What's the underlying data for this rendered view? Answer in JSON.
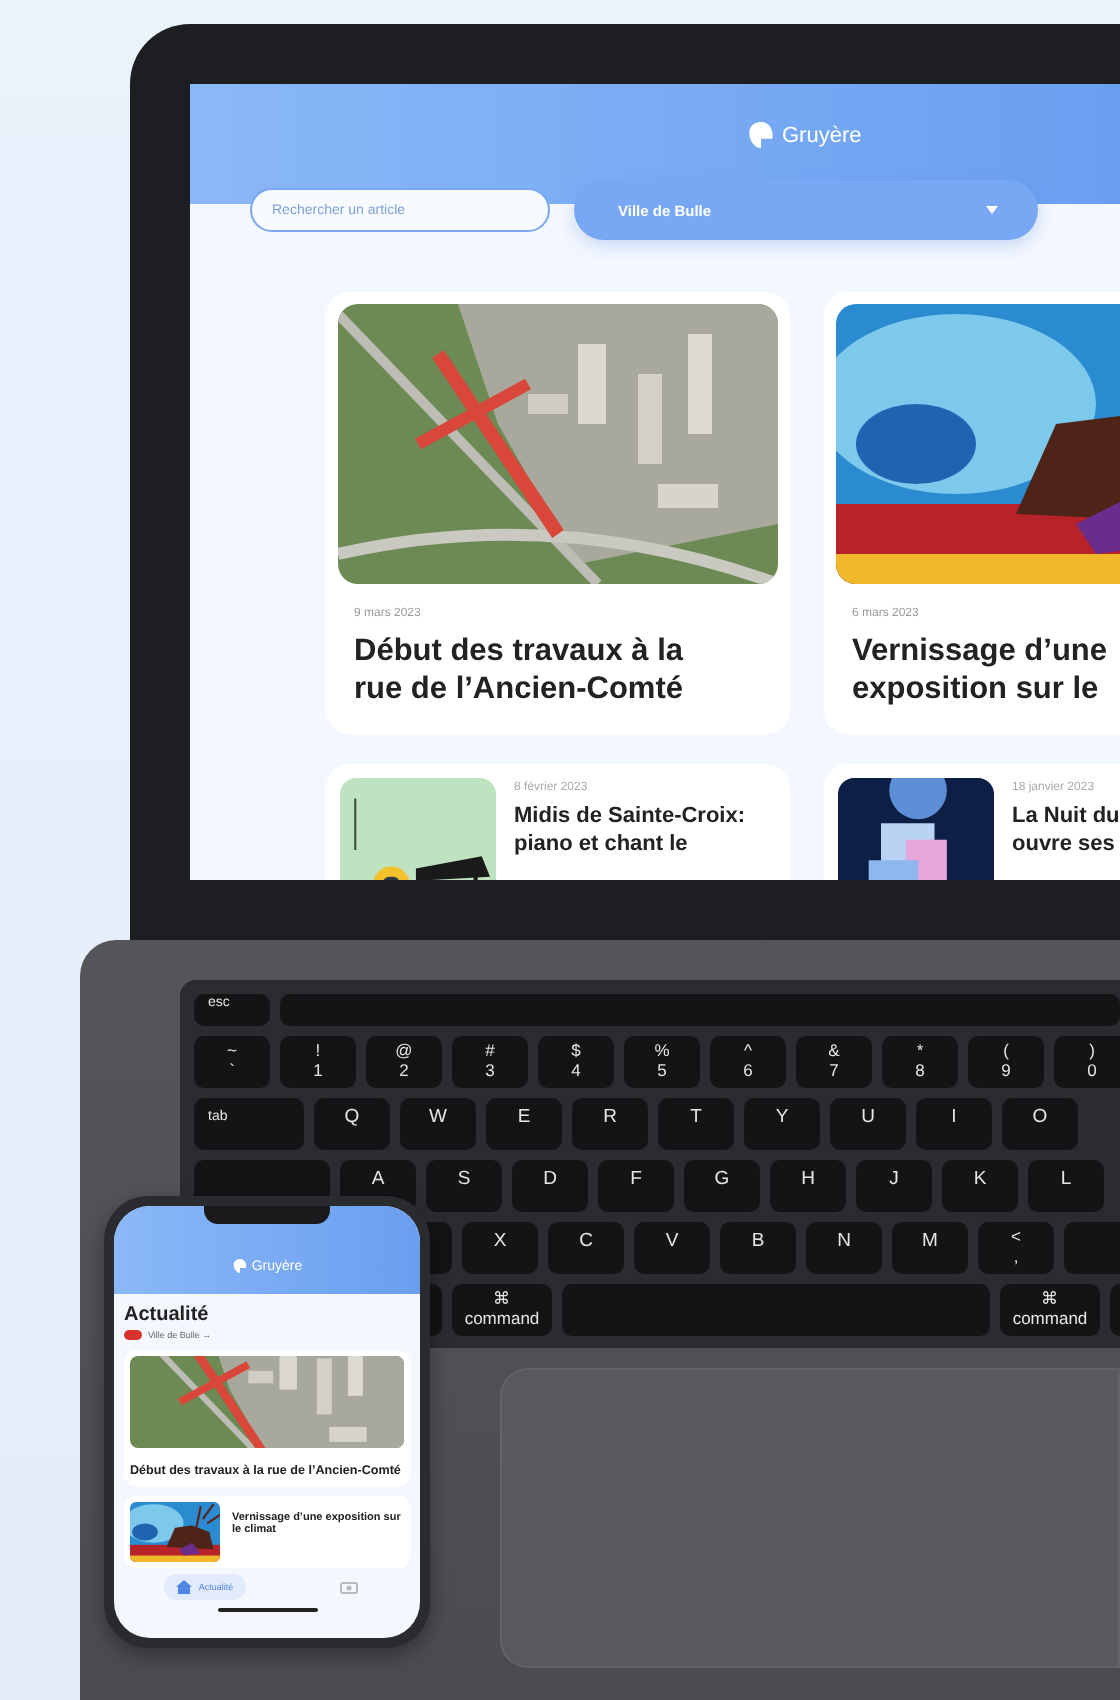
{
  "laptop": {
    "site": {
      "logo": "Gruyère",
      "search": {
        "placeholder": "Rechercher un article"
      },
      "location_select": {
        "value": "Ville de Bulle"
      },
      "featured": [
        {
          "date": "9 mars 2023",
          "title_lines": [
            "Début des travaux à la",
            "rue de l’Ancien-Comté"
          ]
        },
        {
          "date": "6 mars 2023",
          "title_lines": [
            "Vernissage d’une",
            "exposition sur le"
          ]
        }
      ],
      "more": [
        {
          "date": "8 février 2023",
          "title_lines": [
            "Midis de Sainte-Croix:",
            "piano et chant le"
          ]
        },
        {
          "date": "18 janvier 2023",
          "title_lines": [
            "La Nuit du",
            "ouvre ses"
          ]
        }
      ]
    },
    "keyboard": [
      [
        {
          "kind": "esc",
          "lines": [
            "esc"
          ]
        },
        {
          "kind": "bar"
        }
      ],
      [
        {
          "kind": "key",
          "lines": [
            "~",
            "`"
          ]
        },
        {
          "kind": "key",
          "lines": [
            "!",
            "1"
          ]
        },
        {
          "kind": "key",
          "lines": [
            "@",
            "2"
          ]
        },
        {
          "kind": "key",
          "lines": [
            "#",
            "3"
          ]
        },
        {
          "kind": "key",
          "lines": [
            "$",
            "4"
          ]
        },
        {
          "kind": "key",
          "lines": [
            "%",
            "5"
          ]
        },
        {
          "kind": "key",
          "lines": [
            "^",
            "6"
          ]
        },
        {
          "kind": "key",
          "lines": [
            "&",
            "7"
          ]
        },
        {
          "kind": "key",
          "lines": [
            "*",
            "8"
          ]
        },
        {
          "kind": "key",
          "lines": [
            "(",
            "9"
          ]
        },
        {
          "kind": "key",
          "lines": [
            ")",
            "0"
          ]
        }
      ],
      [
        {
          "kind": "tab",
          "lines": [
            "tab"
          ]
        },
        {
          "kind": "key",
          "lines": [
            "Q"
          ]
        },
        {
          "kind": "key",
          "lines": [
            "W"
          ]
        },
        {
          "kind": "key",
          "lines": [
            "E"
          ]
        },
        {
          "kind": "key",
          "lines": [
            "R"
          ]
        },
        {
          "kind": "key",
          "lines": [
            "T"
          ]
        },
        {
          "kind": "key",
          "lines": [
            "Y"
          ]
        },
        {
          "kind": "key",
          "lines": [
            "U"
          ]
        },
        {
          "kind": "key",
          "lines": [
            "I"
          ]
        },
        {
          "kind": "key",
          "lines": [
            "O"
          ]
        }
      ],
      [
        {
          "kind": "caps"
        },
        {
          "kind": "key",
          "lines": [
            "A"
          ]
        },
        {
          "kind": "key",
          "lines": [
            "S"
          ]
        },
        {
          "kind": "key",
          "lines": [
            "D"
          ]
        },
        {
          "kind": "key",
          "lines": [
            "F"
          ]
        },
        {
          "kind": "key",
          "lines": [
            "G"
          ]
        },
        {
          "kind": "key",
          "lines": [
            "H"
          ]
        },
        {
          "kind": "key",
          "lines": [
            "J"
          ]
        },
        {
          "kind": "key",
          "lines": [
            "K"
          ]
        },
        {
          "kind": "key",
          "lines": [
            "L"
          ]
        }
      ],
      [
        {
          "kind": "shift"
        },
        {
          "kind": "key",
          "lines": [
            "X"
          ]
        },
        {
          "kind": "key",
          "lines": [
            "C"
          ]
        },
        {
          "kind": "key",
          "lines": [
            "V"
          ]
        },
        {
          "kind": "key",
          "lines": [
            "B"
          ]
        },
        {
          "kind": "key",
          "lines": [
            "N"
          ]
        },
        {
          "kind": "key",
          "lines": [
            "M"
          ]
        },
        {
          "kind": "key",
          "lines": [
            "<",
            ","
          ]
        },
        {
          "kind": "blank"
        }
      ],
      [
        {
          "kind": "mods"
        },
        {
          "kind": "command",
          "lines": [
            "⌘",
            "command"
          ]
        },
        {
          "kind": "space"
        },
        {
          "kind": "command",
          "lines": [
            "⌘",
            "command"
          ]
        },
        {
          "kind": "blank"
        }
      ]
    ]
  },
  "phone": {
    "logo": "Gruyère",
    "heading": "Actualité",
    "location": "Ville de Bulle →",
    "featured": {
      "title": "Début des travaux à la rue de l’Ancien-Comté"
    },
    "next": {
      "title": "Vernissage d’une exposition sur le climat"
    },
    "nav": [
      {
        "label": "Actualité",
        "selected": true,
        "kind": "home"
      },
      {
        "selected": false,
        "kind": "camera"
      }
    ]
  }
}
